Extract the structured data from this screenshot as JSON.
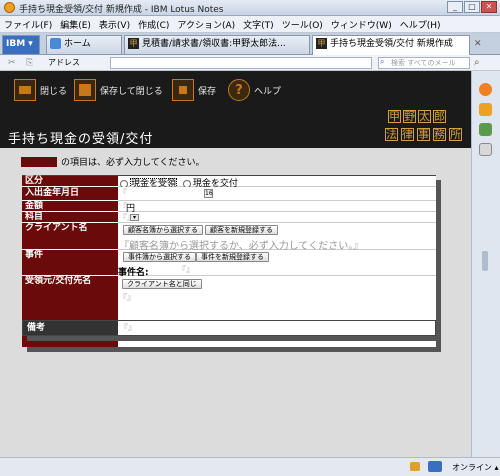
{
  "window": {
    "title": "手持ち現金受領/交付 新規作成 - IBM Lotus Notes"
  },
  "menu": [
    "ファイル(F)",
    "編集(E)",
    "表示(V)",
    "作成(C)",
    "アクション(A)",
    "文字(T)",
    "ツール(O)",
    "ウィンドウ(W)",
    "ヘルプ(H)"
  ],
  "tabs": [
    {
      "label": "ホーム"
    },
    {
      "label": "見積書/請求書/領収書:甲野太郎法..."
    },
    {
      "label": "手持ち現金受領/交付 新規作成"
    }
  ],
  "addressbar": {
    "label": "アドレス",
    "search_placeholder": "検索 すべてのメール"
  },
  "actions": {
    "close": "閉じる",
    "save_close": "保存して閉じる",
    "save": "保存",
    "help": "ヘルプ"
  },
  "form": {
    "title": "手持ち現金の受領/交付",
    "logo_top": [
      "甲",
      "野",
      "太",
      "郎"
    ],
    "logo_bottom": [
      "法",
      "律",
      "事",
      "務",
      "所"
    ],
    "required_notice": "の項目は、必ず入力してください。",
    "fields": {
      "kubun_label": "区分",
      "radio_receive": "現金を受領",
      "radio_give": "現金を交付",
      "date_label": "入出金年月日",
      "date_value": "16",
      "amount_label": "金額",
      "amount_unit": "円",
      "subject_label": "科目",
      "client_label": "クライアント名",
      "client_select_btn": "顧客名簿から選択する",
      "client_new_btn": "顧客を新規登録する",
      "client_placeholder": "顧客名簿から選択するか、必ず入力してください。",
      "case_label": "事件",
      "case_select_btn": "事件簿から選択する",
      "case_new_btn": "事件を新規登録する",
      "case_name_label": "事件名:",
      "recipient_label": "受領元/交付先名",
      "same_as_client_btn": "クライアント名と同じ",
      "remarks_label": "備考"
    }
  },
  "status": {
    "online": "オンライン"
  },
  "colors": {
    "label_bg": "#6b0a0a",
    "actionbar_bg": "#1a1a1a",
    "logo_gold": "#d4a040"
  }
}
